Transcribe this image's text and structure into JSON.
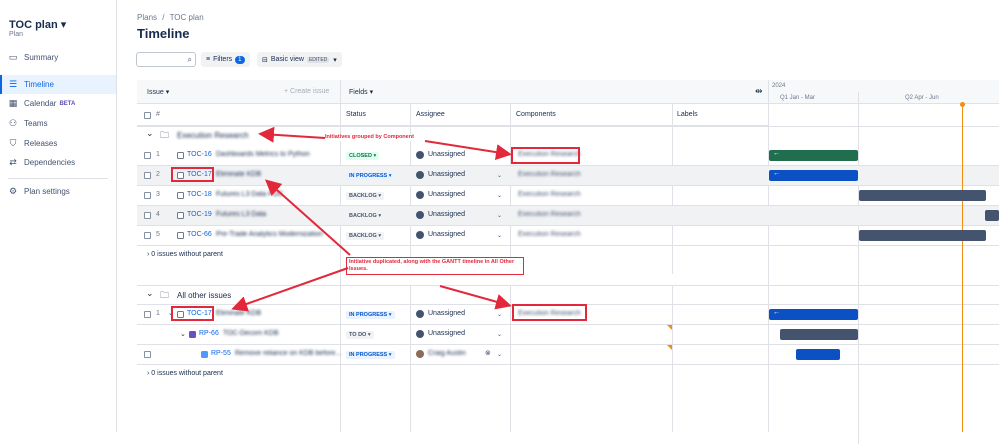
{
  "sidebar": {
    "plan_title": "TOC plan",
    "plan_sub": "Plan",
    "items": [
      {
        "label": "Summary",
        "icon": "summary-icon"
      },
      {
        "label": "Timeline",
        "icon": "timeline-icon"
      },
      {
        "label": "Calendar",
        "icon": "calendar-icon",
        "badge": "BETA"
      },
      {
        "label": "Teams",
        "icon": "teams-icon"
      },
      {
        "label": "Releases",
        "icon": "releases-icon"
      },
      {
        "label": "Dependencies",
        "icon": "dependencies-icon"
      }
    ],
    "settings": "Plan settings"
  },
  "header": {
    "breadcrumb_root": "Plans",
    "breadcrumb_sep": "/",
    "breadcrumb_plan": "TOC plan",
    "title": "Timeline",
    "filters_label": "Filters",
    "filters_count": "1",
    "view_label": "Basic view",
    "view_badge": "EDITED"
  },
  "table": {
    "issue_header": "Issue",
    "create_issue": "+ Create issue",
    "fields_header": "Fields",
    "col_hash": "#",
    "col_status": "Status",
    "col_assignee": "Assignee",
    "col_components": "Components",
    "col_labels": "Labels"
  },
  "timeline": {
    "year": "2024",
    "q1": "Q1 Jan - Mar",
    "q2": "Q2 Apr - Jun"
  },
  "groups": [
    {
      "name": "Execution Research",
      "rows": [
        {
          "num": "1",
          "key": "TOC-16",
          "summary": "Dashboards Metrics to Python",
          "status": "CLOSED",
          "assignee": "Unassigned",
          "component": "Execution Research"
        },
        {
          "num": "2",
          "key": "TOC-17",
          "summary": "Eliminate KDB",
          "status": "IN PROGRESS",
          "assignee": "Unassigned",
          "component": "Execution Research"
        },
        {
          "num": "3",
          "key": "TOC-18",
          "summary": "Futures L3 Data POC",
          "status": "BACKLOG",
          "assignee": "Unassigned",
          "component": "Execution Research"
        },
        {
          "num": "4",
          "key": "TOC-19",
          "summary": "Futures L3 Data",
          "status": "BACKLOG",
          "assignee": "Unassigned",
          "component": "Execution Research"
        },
        {
          "num": "5",
          "key": "TOC-66",
          "summary": "Pre-Trade Analytics Modernization",
          "status": "BACKLOG",
          "assignee": "Unassigned",
          "component": "Execution Research"
        }
      ],
      "no_parent": "0 issues without parent"
    },
    {
      "name": "All other issues",
      "rows": [
        {
          "num": "1",
          "key": "TOC-17",
          "summary": "Eliminate KDB",
          "status": "IN PROGRESS",
          "assignee": "Unassigned",
          "component": "Execution Research"
        },
        {
          "num": "",
          "key": "RP-66",
          "summary": "TOC-Decom KDB",
          "status": "TO DO",
          "assignee": "Unassigned",
          "component": ""
        },
        {
          "num": "",
          "key": "RP-55",
          "summary": "Remove reliance on KDB before...",
          "status": "IN PROGRESS",
          "assignee": "Craig Austin",
          "component": ""
        }
      ],
      "no_parent": "0 issues without parent"
    }
  ],
  "annotations": {
    "note1": "Initiatives grouped by Component",
    "note2": "Initiative duplicated, along with the GANTT timeline in All Other Issues."
  }
}
